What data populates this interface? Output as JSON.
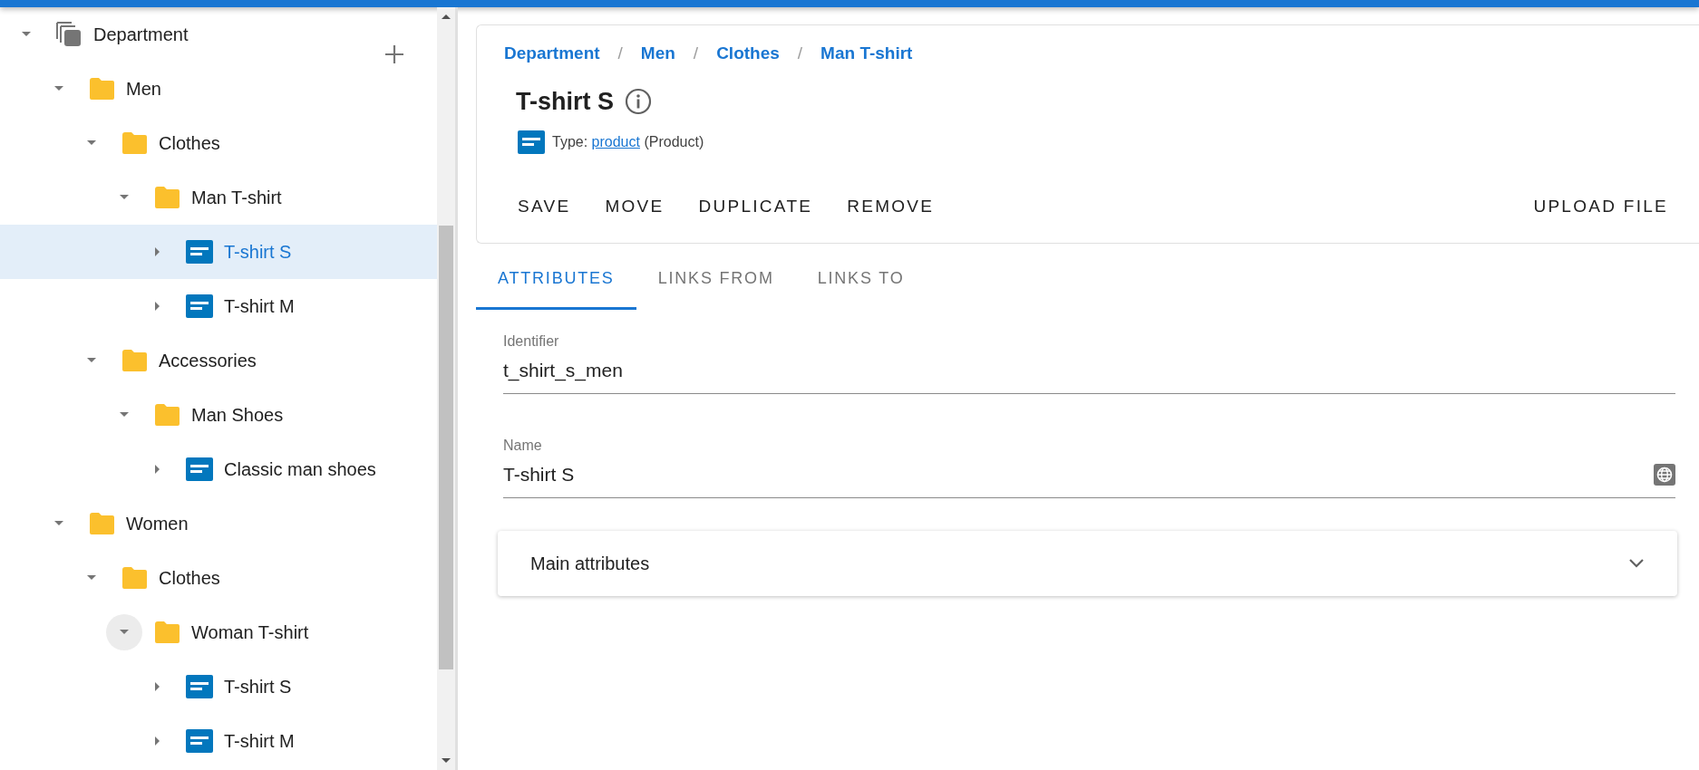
{
  "tree": {
    "root": {
      "label": "Department",
      "kind": "root",
      "expanded": true,
      "selected": false,
      "hovered": false,
      "children": [
        {
          "label": "Men",
          "kind": "folder",
          "expanded": true,
          "selected": false,
          "hovered": false,
          "children": [
            {
              "label": "Clothes",
              "kind": "folder",
              "expanded": true,
              "selected": false,
              "hovered": false,
              "children": [
                {
                  "label": "Man T-shirt",
                  "kind": "folder",
                  "expanded": true,
                  "selected": false,
                  "hovered": false,
                  "children": [
                    {
                      "label": "T-shirt S",
                      "kind": "item",
                      "expanded": false,
                      "selected": true,
                      "hovered": false
                    },
                    {
                      "label": "T-shirt M",
                      "kind": "item",
                      "expanded": false,
                      "selected": false,
                      "hovered": false
                    }
                  ]
                }
              ]
            },
            {
              "label": "Accessories",
              "kind": "folder",
              "expanded": true,
              "selected": false,
              "hovered": false,
              "children": [
                {
                  "label": "Man Shoes",
                  "kind": "folder",
                  "expanded": true,
                  "selected": false,
                  "hovered": false,
                  "children": [
                    {
                      "label": "Classic man shoes",
                      "kind": "item",
                      "expanded": false,
                      "selected": false,
                      "hovered": false
                    }
                  ]
                }
              ]
            }
          ]
        },
        {
          "label": "Women",
          "kind": "folder",
          "expanded": true,
          "selected": false,
          "hovered": false,
          "children": [
            {
              "label": "Clothes",
              "kind": "folder",
              "expanded": true,
              "selected": false,
              "hovered": false,
              "children": [
                {
                  "label": "Woman T-shirt",
                  "kind": "folder",
                  "expanded": true,
                  "selected": false,
                  "hovered": true,
                  "children": [
                    {
                      "label": "T-shirt S",
                      "kind": "item",
                      "expanded": false,
                      "selected": false,
                      "hovered": false
                    },
                    {
                      "label": "T-shirt M",
                      "kind": "item",
                      "expanded": false,
                      "selected": false,
                      "hovered": false
                    }
                  ]
                }
              ]
            }
          ]
        }
      ]
    }
  },
  "breadcrumb": [
    "Department",
    "Men",
    "Clothes",
    "Man T-shirt"
  ],
  "breadcrumb_separator": "/",
  "title": "T-shirt S",
  "type_line": {
    "label": "Type:",
    "link": "product",
    "suffix": "(Product)"
  },
  "actions": [
    "SAVE",
    "MOVE",
    "DUPLICATE",
    "REMOVE"
  ],
  "upload_button": "UPLOAD FILE",
  "tabs": [
    {
      "label": "ATTRIBUTES",
      "selected": true
    },
    {
      "label": "LINKS FROM",
      "selected": false
    },
    {
      "label": "LINKS TO",
      "selected": false
    }
  ],
  "fields": [
    {
      "label": "Identifier",
      "value": "t_shirt_s_men",
      "translatable": false
    },
    {
      "label": "Name",
      "value": "T-shirt S",
      "translatable": true
    }
  ],
  "sections": [
    {
      "title": "Main attributes",
      "expanded": false
    }
  ]
}
